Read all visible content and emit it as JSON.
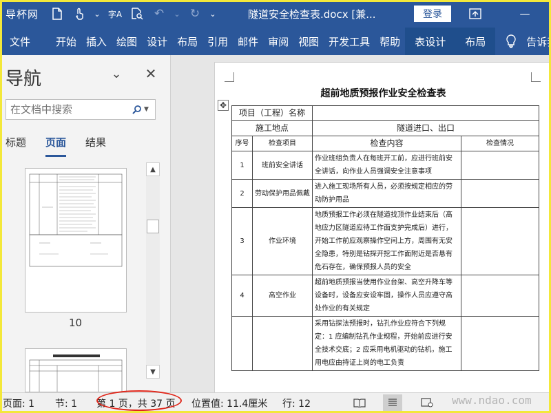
{
  "titlebar": {
    "logo_text": "导杯网",
    "document_title": "隧道安全检查表.docx [兼...",
    "login_label": "登录"
  },
  "ribbon": {
    "tabs": [
      "文件",
      "开始",
      "插入",
      "绘图",
      "设计",
      "布局",
      "引用",
      "邮件",
      "审阅",
      "视图",
      "开发工具",
      "帮助"
    ],
    "contextual_tabs": [
      "表设计",
      "布局"
    ],
    "tell_me": "告诉我"
  },
  "nav_pane": {
    "title": "导航",
    "search_placeholder": "在文档中搜索",
    "tabs": [
      "标题",
      "页面",
      "结果"
    ],
    "active_tab": "页面",
    "thumb_page_number": "10"
  },
  "document": {
    "heading": "超前地质预报作业安全检查表",
    "project_label": "项目（工程）名称",
    "location_label": "施工地点",
    "location_value": "隧道进口、出口",
    "columns": [
      "序号",
      "检查项目",
      "检查内容",
      "检查情况"
    ],
    "rows": [
      {
        "no": "1",
        "item": "班前安全讲话",
        "content": "作业班组负责人在每班开工前，应进行班前安全讲话，向作业人员强调安全注意事项"
      },
      {
        "no": "2",
        "item": "劳动保护用品佩戴",
        "content": "进入施工现场所有人员，必须按规定相应的劳动防护用品"
      },
      {
        "no": "3",
        "item": "作业环境",
        "content": "地质预报工作必须在隧道找顶作业结束后（高地应力区隧道应待工作面支护完成后）进行，开始工作前应观察操作空间上方，周围有无安全隐患，特别是钻探开挖工作面附近是否悬有危石存在，确保预报人员的安全"
      },
      {
        "no": "4",
        "item": "高空作业",
        "content": "超前地质预报当使用作业台架、高空升降车等设备时，设备应安设牢固，操作人员应遵守高处作业的有关规定"
      },
      {
        "no": "",
        "item": "",
        "content": "采用钻探法预报时，钻孔作业应符合下列规定：1 应编制钻孔作业规程，开始前应进行安全技术交底；2 应采用电机驱动的钻机，施工用电应由持证上岗的电工负责"
      }
    ]
  },
  "status_bar": {
    "page": "页面: 1",
    "section": "节: 1",
    "page_of": "第 1 页，共 37 页",
    "position": "位置值: 11.4厘米",
    "line": "行: 12"
  },
  "watermark": "www.ndao.com",
  "colors": {
    "ribbon_blue": "#2b579a",
    "highlight_red": "#e0261a",
    "frame_yellow": "#f3e83a"
  }
}
